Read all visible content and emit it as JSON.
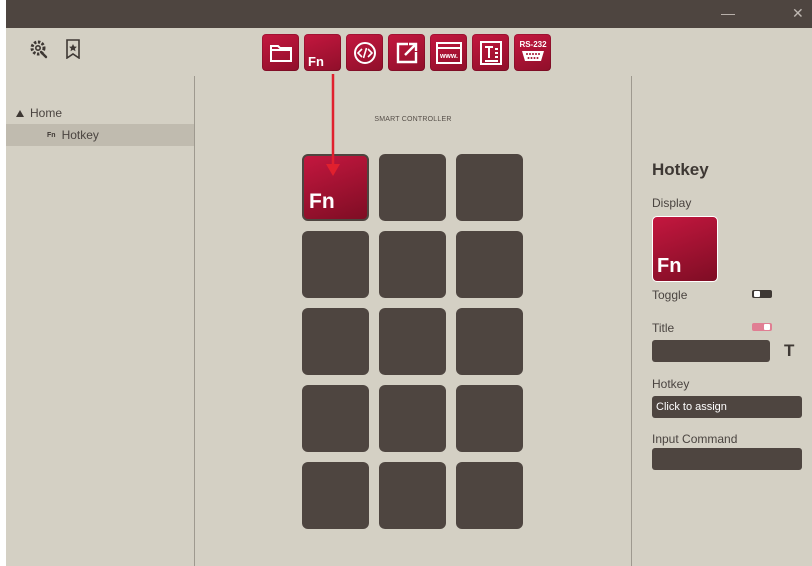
{
  "window": {
    "minimize_glyph": "—",
    "close_glyph": "✕"
  },
  "toolbar": {
    "left_icons": [
      "settings-gear-icon",
      "bookmark-star-icon"
    ]
  },
  "actions": [
    {
      "name": "folder-action",
      "icon": "folder-icon"
    },
    {
      "name": "fn-action",
      "label": "Fn"
    },
    {
      "name": "code-action",
      "icon": "code-icon"
    },
    {
      "name": "open-link-action",
      "icon": "external-link-icon"
    },
    {
      "name": "website-action",
      "icon": "www-icon",
      "label": "www."
    },
    {
      "name": "text-action",
      "icon": "text-document-icon"
    },
    {
      "name": "rs232-action",
      "icon": "serial-port-icon",
      "label": "RS-232"
    }
  ],
  "tree": {
    "home_label": "Home",
    "hotkey_prefix": "Fn",
    "hotkey_label": "Hotkey"
  },
  "grid": {
    "caption": "SMART CONTROLLER",
    "active_key_label": "Fn",
    "rows": 5,
    "cols": 3
  },
  "inspector": {
    "title": "Hotkey",
    "display_label": "Display",
    "display_key_label": "Fn",
    "toggle_label": "Toggle",
    "toggle_on": false,
    "title_label": "Title",
    "title_toggle_on": true,
    "title_value": "",
    "hotkey_label": "Hotkey",
    "hotkey_value": "Click to assign",
    "input_command_label": "Input Command",
    "input_command_value": ""
  },
  "colors": {
    "accent": "#b5133a",
    "tile": "#4e4540",
    "background": "#d4d0c4",
    "arrow": "#e0202e",
    "title_toggle": "#e07e93"
  }
}
